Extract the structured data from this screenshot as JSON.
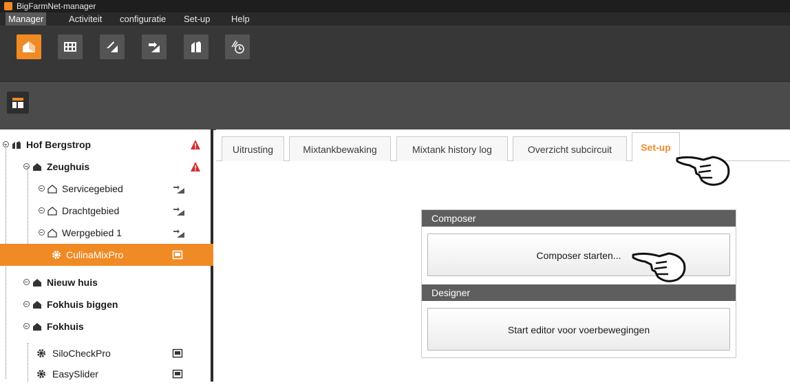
{
  "window": {
    "title": "BigFarmNet-manager"
  },
  "menu": [
    "Manager",
    "Activiteit",
    "configuratie",
    "Set-up",
    "Help"
  ],
  "toolbar": {
    "buttons": [
      "home-icon",
      "grid-icon",
      "transfer-in-icon",
      "transfer-out-icon",
      "barn-icon",
      "feed-timer-icon"
    ]
  },
  "toolbar2": {
    "button": "layout-icon"
  },
  "tree": {
    "root": "Hof Bergstrop",
    "items": [
      {
        "label": "Zeughuis"
      },
      {
        "label": "Servicegebied"
      },
      {
        "label": "Drachtgebied"
      },
      {
        "label": "Werpgebied 1"
      },
      {
        "label": "CulinaMixPro"
      },
      {
        "label": "Nieuw huis"
      },
      {
        "label": "Fokhuis biggen"
      },
      {
        "label": "Fokhuis"
      },
      {
        "label": "SiloCheckPro"
      },
      {
        "label": "EasySlider"
      }
    ]
  },
  "tabs": [
    "Uitrusting",
    "Mixtankbewaking",
    "Mixtank history log",
    "Overzicht subcircuit",
    "Set-up"
  ],
  "composer": {
    "header": "Composer",
    "button": "Composer starten..."
  },
  "designer": {
    "header": "Designer",
    "button": "Start editor voor voerbewegingen"
  },
  "colors": {
    "accent": "#f08a24",
    "alert": "#d32f2f",
    "dark": "#373737"
  }
}
